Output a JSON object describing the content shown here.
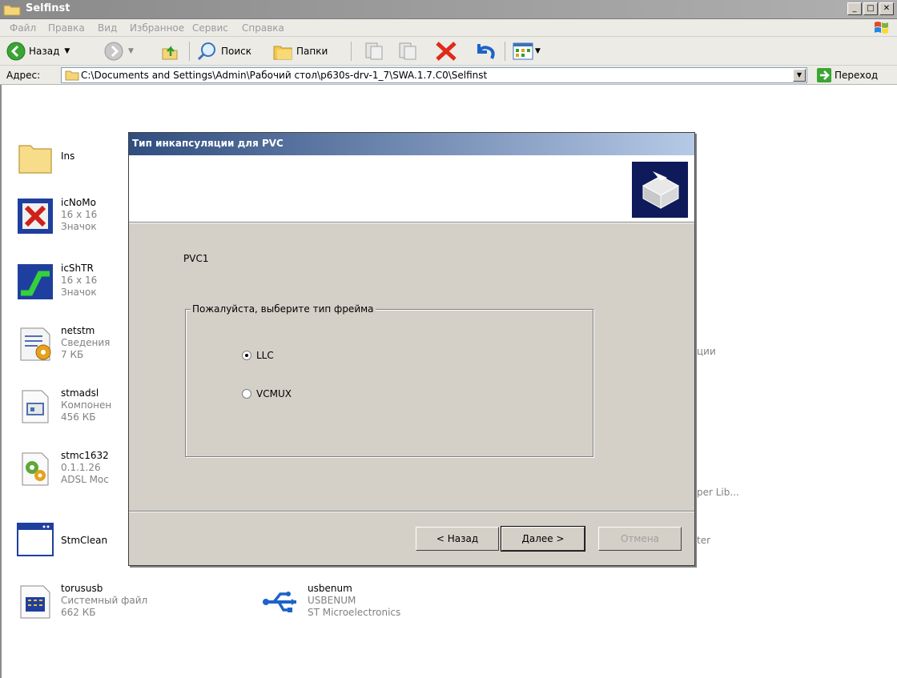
{
  "window": {
    "title": "Selfinst",
    "buttons": {
      "minimize": "_",
      "maximize": "□",
      "close": "✕"
    }
  },
  "menu": [
    "Файл",
    "Правка",
    "Вид",
    "Избранное",
    "Сервис",
    "Справка"
  ],
  "toolbar": {
    "back_label": "Назад",
    "search_label": "Поиск",
    "folders_label": "Папки"
  },
  "address": {
    "label": "Адрес:",
    "path": "C:\\Documents and Settings\\Admin\\Рабочий стол\\p630s-drv-1_7\\SWA.1.7.C0\\Selfinst",
    "go_label": "Переход"
  },
  "files": [
    {
      "name": "Ins",
      "icon": "folder-icon"
    },
    {
      "name": "icNoMo",
      "line1": "16 x 16",
      "line2": "Значок",
      "icon": "red-x-icon"
    },
    {
      "name": "icShTR",
      "line1": "16 x 16",
      "line2": "Значок",
      "icon": "green-line-icon"
    },
    {
      "name": "netstm",
      "line1": "Сведения",
      "line2": "7 КБ",
      "icon": "setup-info-icon"
    },
    {
      "name": "stmadsl",
      "line1": "Компонен",
      "line2": "456 КБ",
      "icon": "component-icon"
    },
    {
      "name": "stmc1632",
      "line1": "0.1.1.26",
      "line2": "ADSL Moc",
      "icon": "dll-gear-icon"
    },
    {
      "name": "StmClean",
      "icon": "app-window-icon"
    },
    {
      "name": "torususb",
      "line1": "Системный файл",
      "line2": "662 КБ",
      "icon": "system-file-icon"
    },
    {
      "name": "usbenum",
      "line1": "USBENUM",
      "line2": "ST Microelectronics",
      "icon": "usb-icon"
    }
  ],
  "stray_texts": {
    "ции": "ции",
    "lib": "per Lib...",
    "ter": "ter"
  },
  "dialog": {
    "title": "Тип инкапсуляции для PVC",
    "pvc_label": "PVC1",
    "group_label": "Пожалуйста, выберите тип фрейма",
    "options": [
      {
        "label": "LLC",
        "selected": true
      },
      {
        "label": "VCMUX",
        "selected": false
      }
    ],
    "back_button": "< Назад",
    "next_button": "Далее >",
    "cancel_button": "Отмена"
  }
}
